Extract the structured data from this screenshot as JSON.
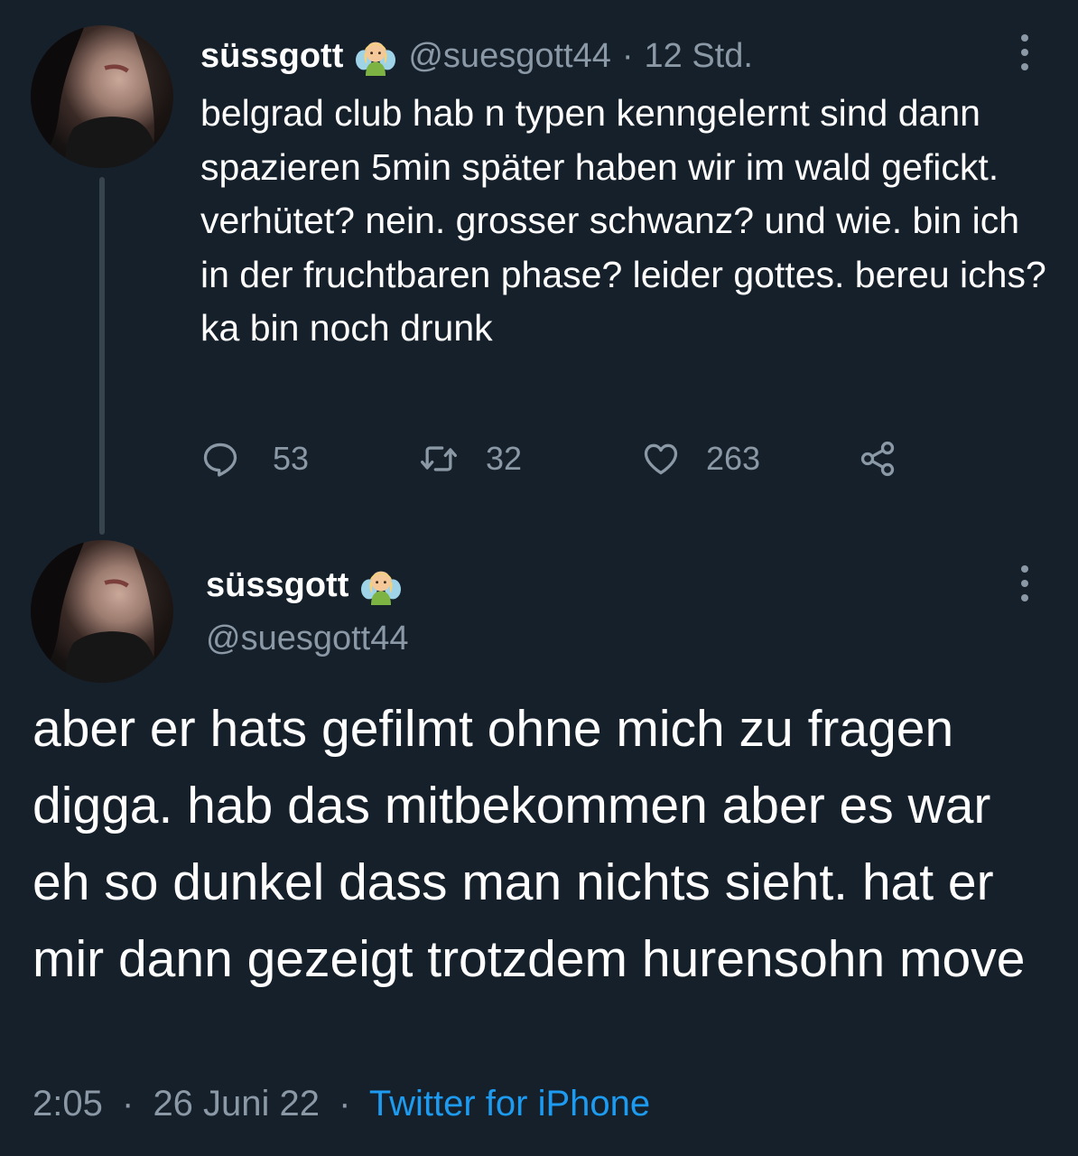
{
  "tweet1": {
    "display_name": "süssgott",
    "emoji": "fairy-emoji",
    "handle": "@suesgott44",
    "separator": "·",
    "time": "12 Std.",
    "text": "belgrad club hab n typen kenngelernt sind dann spazieren 5min später haben wir im wald gefickt. verhütet? nein. grosser schwanz? und wie. bin ich in der fruchtbaren phase? leider gottes. bereu ichs? ka bin noch drunk",
    "replies": "53",
    "retweets": "32",
    "likes": "263"
  },
  "tweet2": {
    "display_name": "süssgott",
    "emoji": "fairy-emoji",
    "handle": "@suesgott44",
    "text": "aber er hats gefilmt ohne mich zu fragen digga. hab das mitbekommen aber es war eh so dunkel dass man nichts sieht. hat er mir dann gezeigt trotzdem hurensohn move",
    "time": "2:05",
    "separator": "·",
    "date": "26 Juni 22",
    "source": "Twitter for iPhone"
  },
  "colors": {
    "background": "#15202b",
    "text": "#ffffff",
    "muted": "#8b98a5",
    "link": "#1d9bf0",
    "thread_line": "#38444d"
  },
  "icons": [
    "reply-icon",
    "retweet-icon",
    "like-icon",
    "share-icon",
    "more-options-icon",
    "fairy-emoji",
    "avatar"
  ]
}
